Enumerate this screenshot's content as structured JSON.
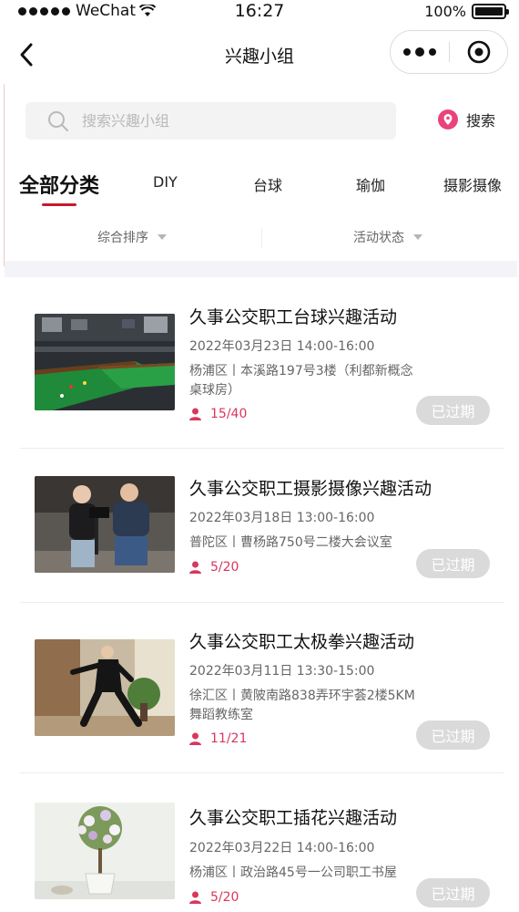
{
  "status_bar": {
    "carrier": "WeChat",
    "time": "16:27",
    "battery": "100%",
    "battery_level": 1.0
  },
  "nav": {
    "title": "兴趣小组"
  },
  "search": {
    "placeholder": "搜索兴趣小组",
    "button_label": "搜索"
  },
  "tabs": [
    {
      "label": "全部分类",
      "active": true
    },
    {
      "label": "DIY"
    },
    {
      "label": "台球"
    },
    {
      "label": "瑜伽"
    },
    {
      "label": "摄影摄像"
    }
  ],
  "filters": [
    {
      "label": "综合排序"
    },
    {
      "label": "活动状态"
    }
  ],
  "colors": {
    "accent": "#c8192c",
    "count": "#d9365e",
    "expired_button": "#dadada",
    "search_icon": "#e9437a"
  },
  "activities": [
    {
      "title": "久事公交职工台球兴趣活动",
      "time": "2022年03月23日 14:00-16:00",
      "location": "杨浦区丨本溪路197号3楼（利都新概念桌球房）",
      "count": "15/40",
      "status": "已过期",
      "image": "billiards-photo"
    },
    {
      "title": "久事公交职工摄影摄像兴趣活动",
      "time": "2022年03月18日 13:00-16:00",
      "location": "普陀区丨曹杨路750号二楼大会议室",
      "count": "5/20",
      "status": "已过期",
      "image": "photography-photo"
    },
    {
      "title": "久事公交职工太极拳兴趣活动",
      "time": "2022年03月11日 13:30-15:00",
      "location": "徐汇区丨黄陂南路838弄环宇荟2楼5KM舞蹈教练室",
      "count": "11/21",
      "status": "已过期",
      "image": "taichi-photo"
    },
    {
      "title": "久事公交职工插花兴趣活动",
      "time": "2022年03月22日 14:00-16:00",
      "location": "杨浦区丨政治路45号一公司职工书屋",
      "count": "5/20",
      "status": "已过期",
      "image": "flower-photo"
    }
  ]
}
